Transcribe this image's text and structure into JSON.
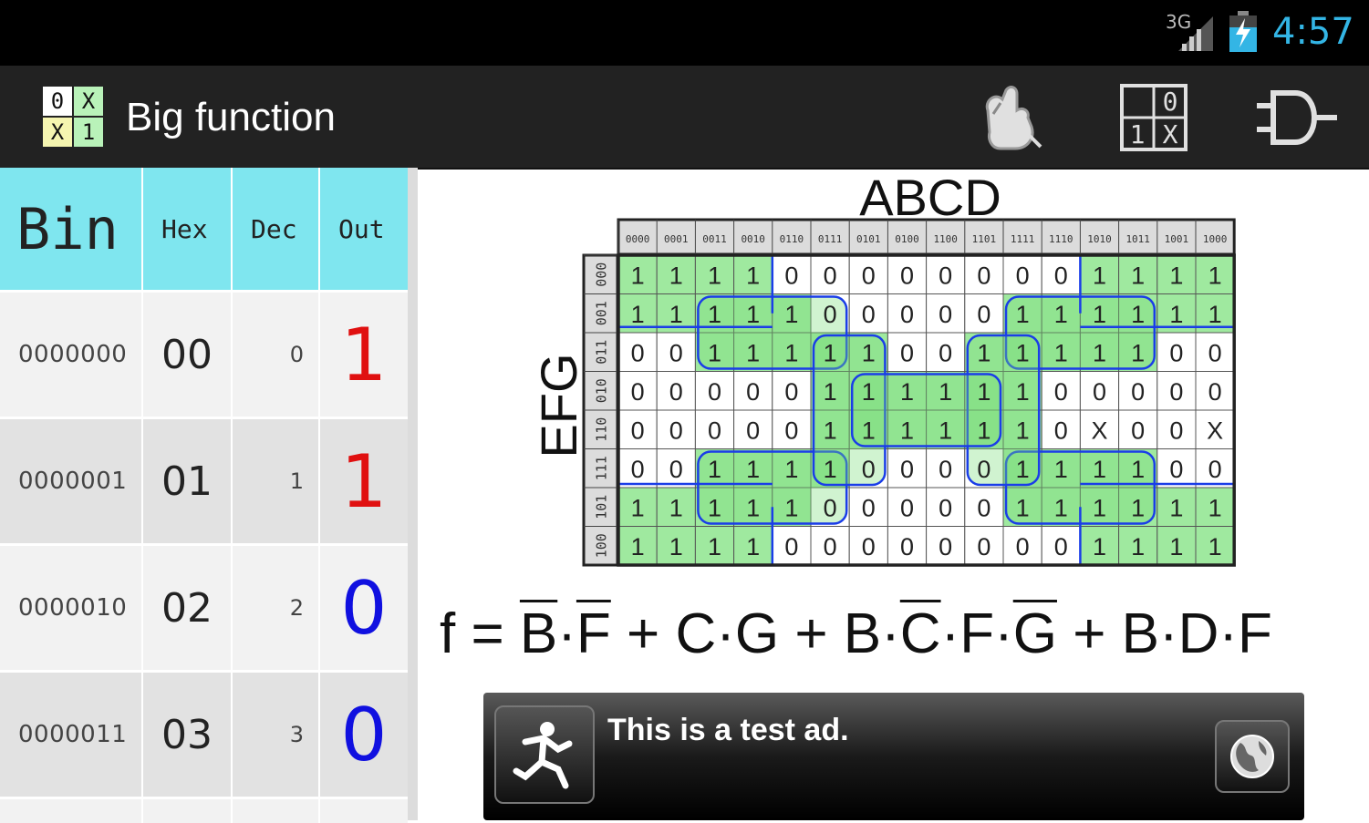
{
  "status_bar": {
    "network": "3G",
    "time": "4:57"
  },
  "action_bar": {
    "title": "Big function",
    "app_icon_cells": [
      "0",
      "X",
      "X",
      "1"
    ],
    "truth_table_icon_cells": [
      "0",
      "1",
      "X"
    ]
  },
  "table": {
    "headers": {
      "bin": "Bin",
      "hex": "Hex",
      "dec": "Dec",
      "out": "Out"
    },
    "rows": [
      {
        "bin": "0000000",
        "hex": "00",
        "dec": "0",
        "out": "1"
      },
      {
        "bin": "0000001",
        "hex": "01",
        "dec": "1",
        "out": "1"
      },
      {
        "bin": "0000010",
        "hex": "02",
        "dec": "2",
        "out": "0"
      },
      {
        "bin": "0000011",
        "hex": "03",
        "dec": "3",
        "out": "0"
      }
    ]
  },
  "kmap": {
    "col_var_label": "ABCD",
    "row_var_label": "EFG",
    "col_headers": [
      "0000",
      "0001",
      "0011",
      "0010",
      "0110",
      "0111",
      "0101",
      "0100",
      "1100",
      "1101",
      "1111",
      "1110",
      "1010",
      "1011",
      "1001",
      "1000"
    ],
    "row_headers": [
      "000",
      "001",
      "011",
      "010",
      "110",
      "111",
      "101",
      "100"
    ],
    "cells": [
      [
        "1",
        "1",
        "1",
        "1",
        "0",
        "0",
        "0",
        "0",
        "0",
        "0",
        "0",
        "0",
        "1",
        "1",
        "1",
        "1"
      ],
      [
        "1",
        "1",
        "1",
        "1",
        "1",
        "0",
        "0",
        "0",
        "0",
        "0",
        "1",
        "1",
        "1",
        "1",
        "1",
        "1"
      ],
      [
        "0",
        "0",
        "1",
        "1",
        "1",
        "1",
        "1",
        "0",
        "0",
        "1",
        "1",
        "1",
        "1",
        "1",
        "0",
        "0"
      ],
      [
        "0",
        "0",
        "0",
        "0",
        "0",
        "1",
        "1",
        "1",
        "1",
        "1",
        "1",
        "0",
        "0",
        "0",
        "0",
        "0"
      ],
      [
        "0",
        "0",
        "0",
        "0",
        "0",
        "1",
        "1",
        "1",
        "1",
        "1",
        "1",
        "0",
        "X",
        "0",
        "0",
        "X"
      ],
      [
        "0",
        "0",
        "1",
        "1",
        "1",
        "1",
        "0",
        "0",
        "0",
        "0",
        "1",
        "1",
        "1",
        "1",
        "0",
        "0"
      ],
      [
        "1",
        "1",
        "1",
        "1",
        "1",
        "0",
        "0",
        "0",
        "0",
        "0",
        "1",
        "1",
        "1",
        "1",
        "1",
        "1"
      ],
      [
        "1",
        "1",
        "1",
        "1",
        "0",
        "0",
        "0",
        "0",
        "0",
        "0",
        "0",
        "0",
        "1",
        "1",
        "1",
        "1"
      ]
    ],
    "colors": {
      "group_fill": "#9fe99f",
      "group_stroke": "#1a3de8",
      "grid": "#222222"
    }
  },
  "formula": {
    "lead": "f = ",
    "t1": "B",
    "dot1": "·",
    "t2": "F",
    "plus1": " + ",
    "t3": "C·G",
    "plus2": " + ",
    "t4": "B·",
    "t5": "C",
    "t6": "·F·",
    "t7": "G",
    "plus3": " + ",
    "t8": "B·D·F"
  },
  "ad": {
    "text": "This is a test ad."
  },
  "colors": {
    "out_one": "#e01010",
    "out_zero": "#1010e0",
    "header_bg": "#7fe6ef",
    "clock": "#33b5e5"
  }
}
